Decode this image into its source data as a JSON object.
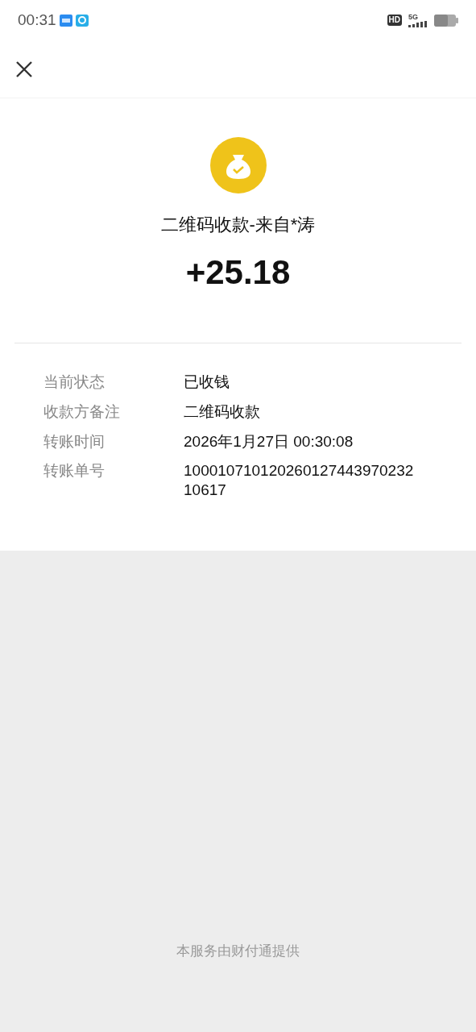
{
  "status_bar": {
    "time": "00:31",
    "hd": "HD",
    "network": "5G"
  },
  "payment": {
    "title": "二维码收款-来自*涛",
    "amount": "+25.18"
  },
  "details": [
    {
      "label": "当前状态",
      "value": "已收钱"
    },
    {
      "label": "收款方备注",
      "value": "二维码收款"
    },
    {
      "label": "转账时间",
      "value": "2026年1月27日 00:30:08"
    },
    {
      "label": "转账单号",
      "value": "10001071012026012744397023210617"
    }
  ],
  "footer": "本服务由财付通提供"
}
